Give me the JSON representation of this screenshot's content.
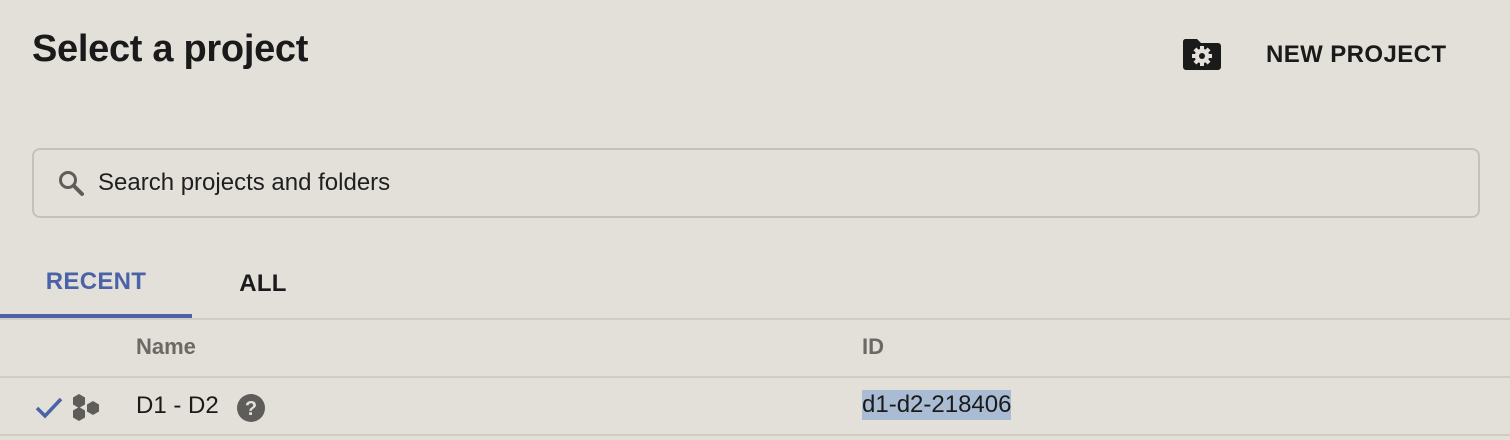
{
  "dialog": {
    "title": "Select a project",
    "manage_resources_icon": "folder-gear-icon",
    "new_project_label": "NEW PROJECT"
  },
  "search": {
    "placeholder": "Search projects and folders",
    "value": "",
    "icon": "search-icon"
  },
  "tabs": [
    {
      "label": "RECENT",
      "active": true
    },
    {
      "label": "ALL",
      "active": false
    }
  ],
  "table": {
    "columns": [
      "Name",
      "ID"
    ],
    "rows": [
      {
        "selected": true,
        "name": "D1 - D2",
        "id": "d1-d2-218406",
        "icons": [
          "check-icon",
          "project-icon",
          "help-icon"
        ]
      }
    ]
  },
  "colors": {
    "background": "#e3e0da",
    "accent": "#4a63a8",
    "id_highlight": "#a9bcd3",
    "divider": "#d0ccc6"
  }
}
